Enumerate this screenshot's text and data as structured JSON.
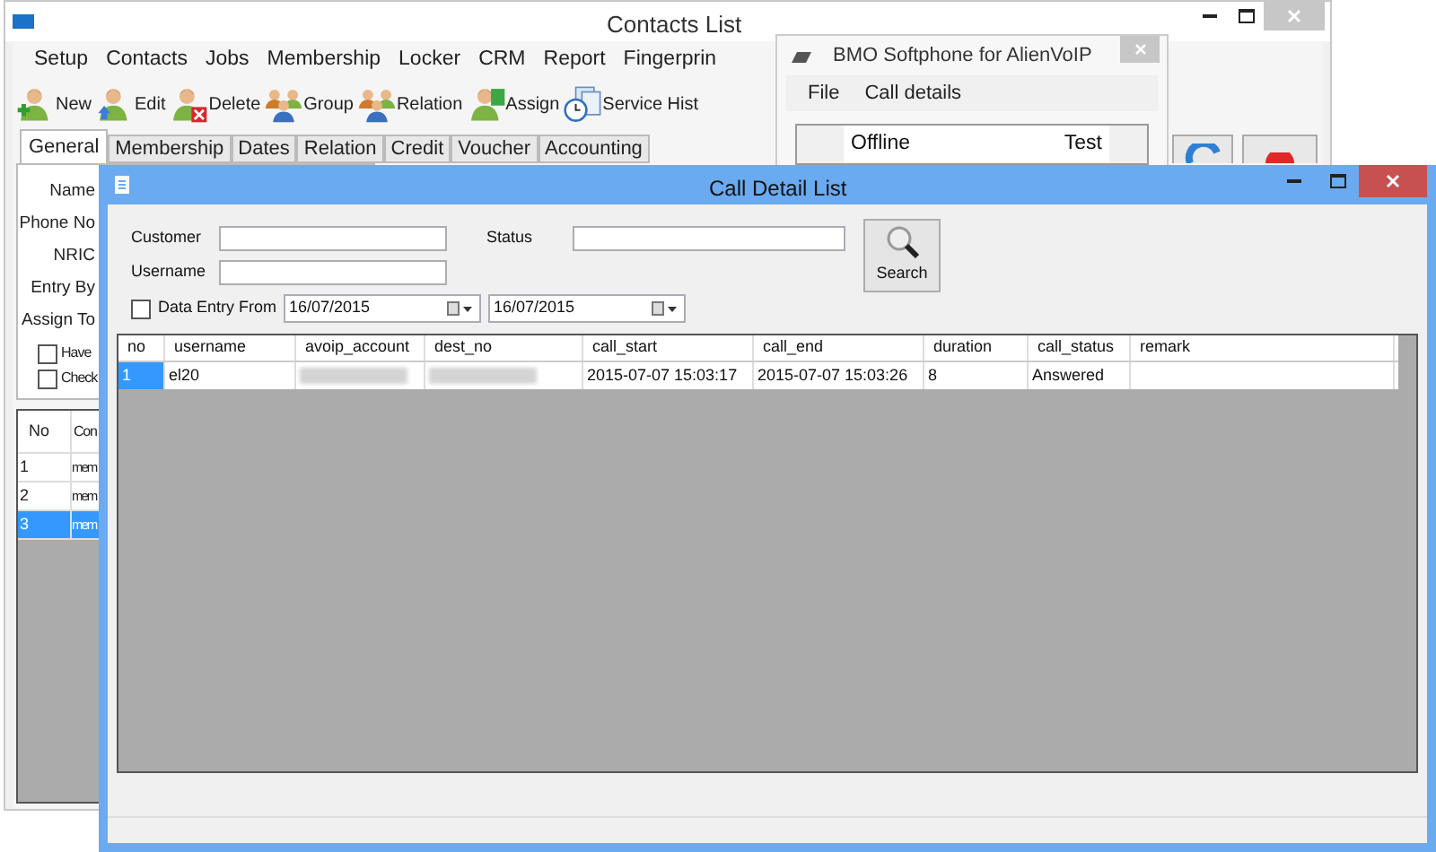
{
  "contacts_window": {
    "title": "Contacts List",
    "menu": [
      "Setup",
      "Contacts",
      "Jobs",
      "Membership",
      "Locker",
      "CRM",
      "Report",
      "Fingerprin"
    ],
    "toolbar": [
      {
        "label": "New"
      },
      {
        "label": "Edit"
      },
      {
        "label": "Delete"
      },
      {
        "label": "Group"
      },
      {
        "label": "Relation"
      },
      {
        "label": "Assign"
      },
      {
        "label": "Service Hist"
      }
    ],
    "tabs": [
      {
        "label": "General",
        "selected": true
      },
      {
        "label": "Membership",
        "selected": false
      },
      {
        "label": "Dates",
        "selected": false
      },
      {
        "label": "Relation",
        "selected": false
      },
      {
        "label": "Credit",
        "selected": false
      },
      {
        "label": "Voucher",
        "selected": false
      },
      {
        "label": "Accounting",
        "selected": false
      }
    ],
    "form_labels": [
      "Name",
      "Phone No",
      "NRIC",
      "Entry By",
      "Assign To"
    ],
    "checkboxes": [
      {
        "label": "Have",
        "checked": false
      },
      {
        "label": "Check",
        "checked": false
      }
    ],
    "grid": {
      "columns": [
        "No",
        "Con"
      ],
      "rows": [
        {
          "no": "1",
          "column_2": "mem",
          "selected": false
        },
        {
          "no": "2",
          "column_2": "mem",
          "selected": false
        },
        {
          "no": "3",
          "column_2": "mem",
          "selected": true
        }
      ]
    }
  },
  "softphone_window": {
    "title": "BMO Softphone for AlienVoIP",
    "menu": [
      "File",
      "Call details"
    ],
    "status": "Offline",
    "account": "Test"
  },
  "call_detail_window": {
    "title": "Call Detail List",
    "filters": {
      "customer_label": "Customer",
      "status_label": "Status",
      "username_label": "Username",
      "date_filter": {
        "label": "Data Entry From",
        "checked": false,
        "from": "16/07/2015",
        "to": "16/07/2015"
      }
    },
    "search_button": "Search",
    "table": {
      "columns": [
        "no",
        "username",
        "avoip_account",
        "dest_no",
        "call_start",
        "call_end",
        "duration",
        "call_status",
        "remark"
      ],
      "rows": [
        {
          "selected": true,
          "cells": [
            {
              "kind": "text",
              "text": "1"
            },
            {
              "kind": "text",
              "text": "el20"
            },
            {
              "kind": "blurred"
            },
            {
              "kind": "blurred"
            },
            {
              "kind": "text",
              "text": "2015-07-07 15:03:17"
            },
            {
              "kind": "text",
              "text": "2015-07-07 15:03:26"
            },
            {
              "kind": "text",
              "text": "8"
            },
            {
              "kind": "text",
              "text": "Answered"
            },
            {
              "kind": "empty"
            }
          ]
        }
      ]
    }
  }
}
